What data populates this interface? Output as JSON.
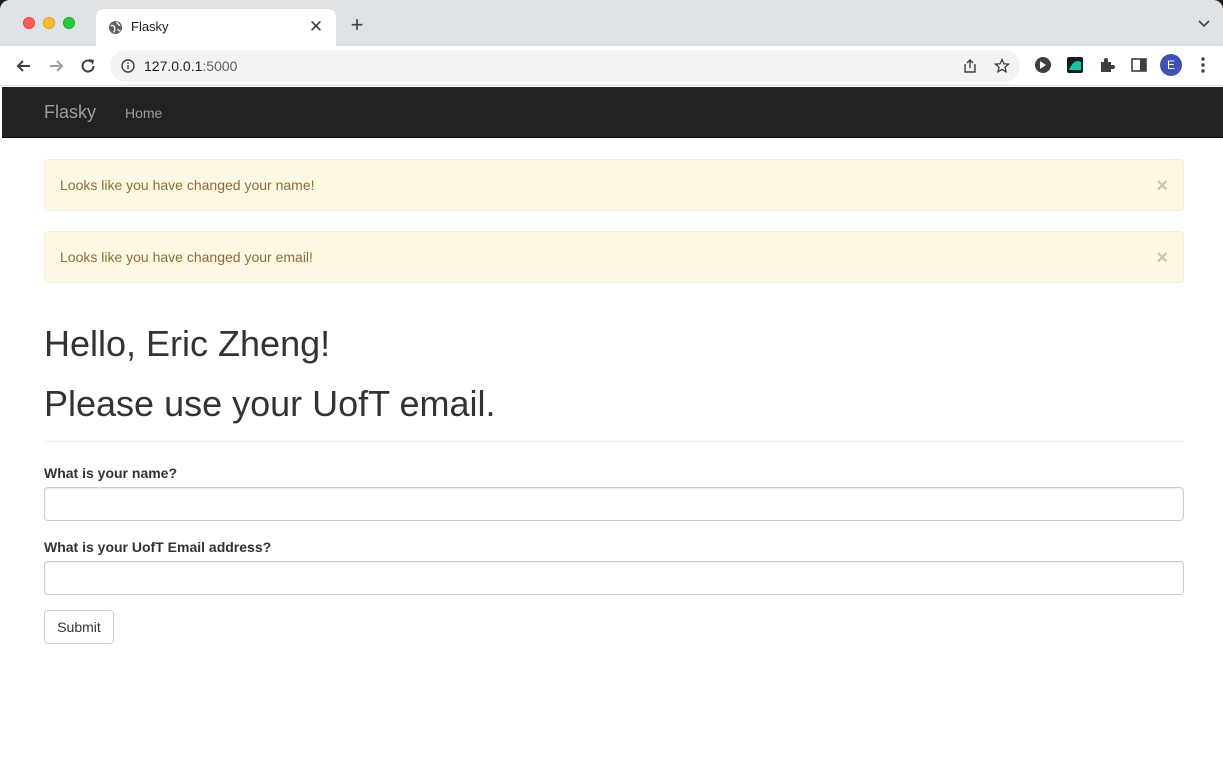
{
  "browser": {
    "tab_title": "Flasky",
    "url_host": "127.0.0.1",
    "url_port": ":5000",
    "profile_initial": "E"
  },
  "site": {
    "brand": "Flasky",
    "nav": {
      "home": "Home"
    }
  },
  "alerts": [
    {
      "text": "Looks like you have changed your name!",
      "close": "×"
    },
    {
      "text": "Looks like you have changed your email!",
      "close": "×"
    }
  ],
  "main": {
    "greeting": "Hello, Eric Zheng!",
    "instruction": "Please use your UofT email."
  },
  "form": {
    "name_label": "What is your name?",
    "name_value": "",
    "email_label": "What is your UofT Email address?",
    "email_value": "",
    "submit_label": "Submit"
  },
  "colors": {
    "navbar": "#222222",
    "alert_bg": "#fcf8e3",
    "alert_text": "#8a6d3b",
    "avatar": "#3f51b5"
  }
}
